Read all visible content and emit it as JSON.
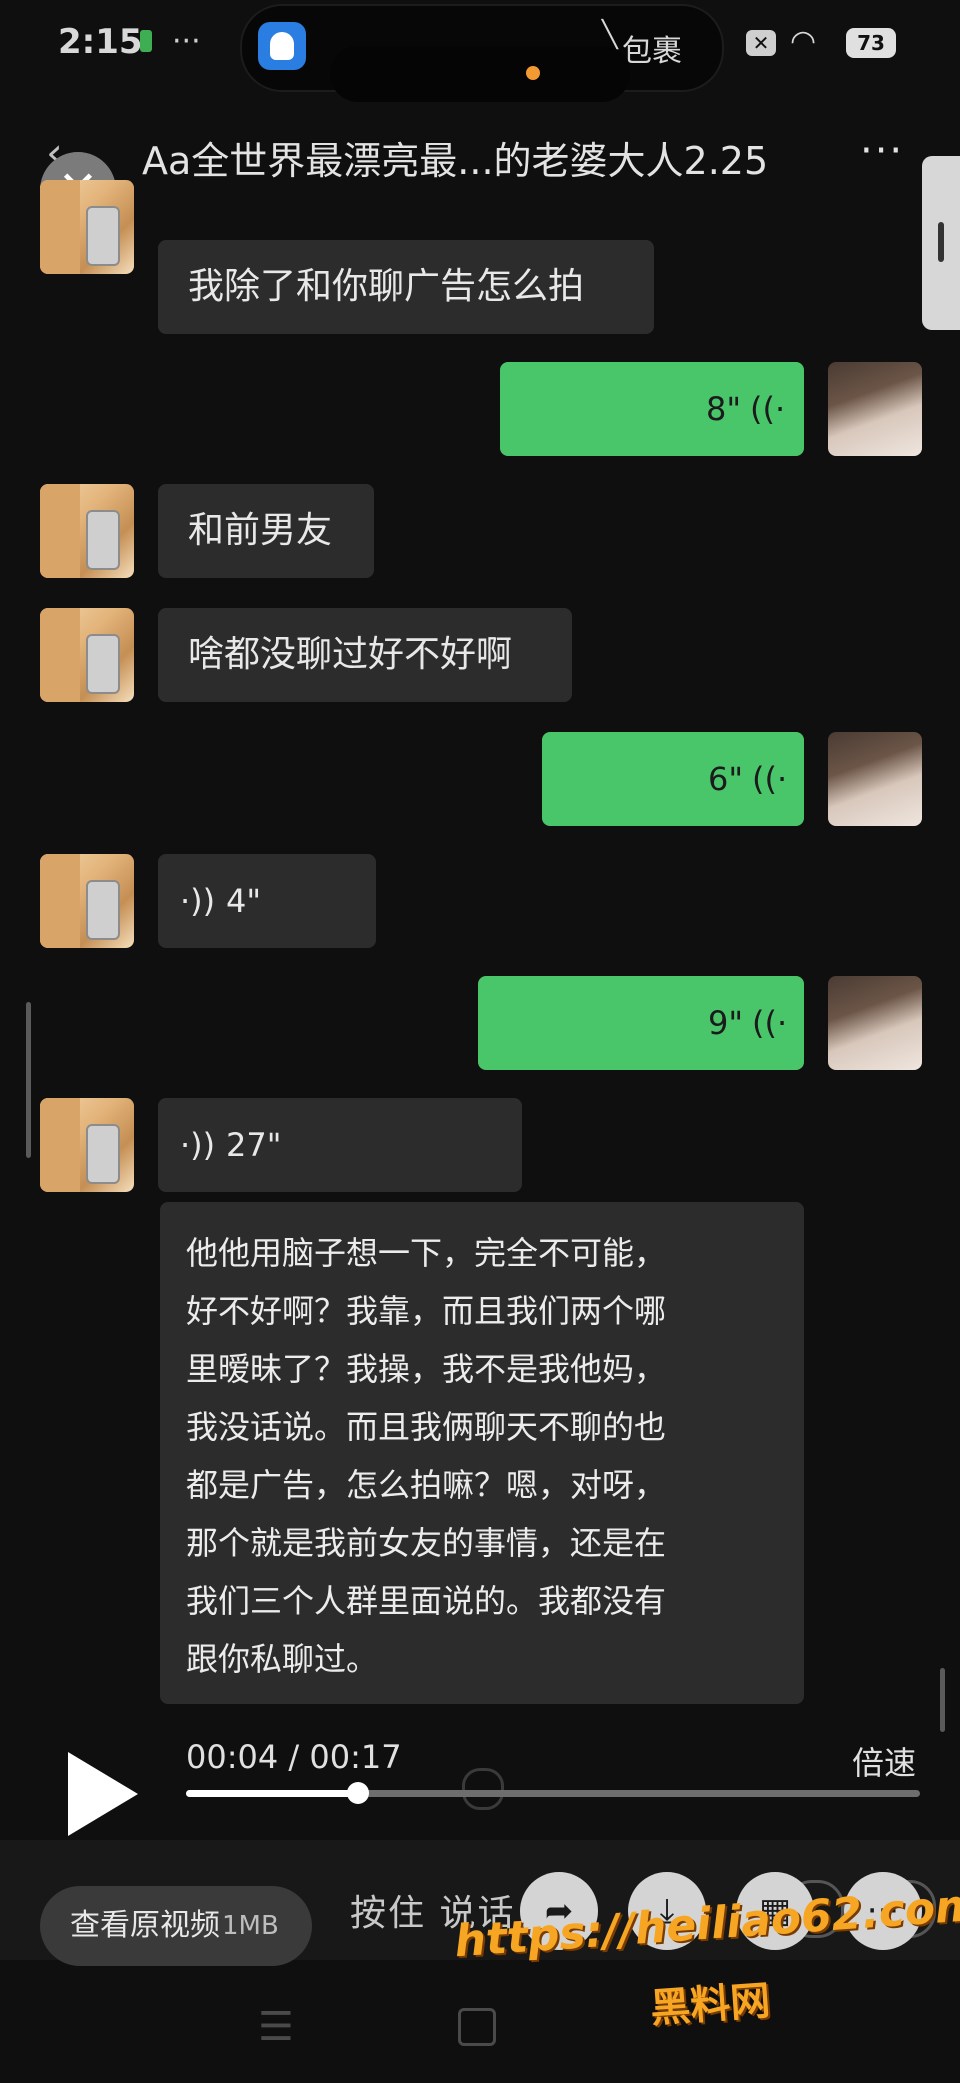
{
  "status_bar": {
    "time": "2:15",
    "dots": "···",
    "island_text": "包裹",
    "battery": "73"
  },
  "header": {
    "title": "Aa全世界最漂亮最...的老婆大人2.25",
    "more": "···",
    "back": "‹",
    "close": "✕"
  },
  "messages": [
    {
      "side": "left",
      "type": "text",
      "text": "我除了和你聊广告怎么拍"
    },
    {
      "side": "right",
      "type": "voice",
      "duration": "8\""
    },
    {
      "side": "left",
      "type": "text",
      "text": "和前男友"
    },
    {
      "side": "left",
      "type": "text",
      "text": "啥都没聊过好不好啊"
    },
    {
      "side": "right",
      "type": "voice",
      "duration": "6\""
    },
    {
      "side": "left",
      "type": "voice",
      "duration": "4\""
    },
    {
      "side": "right",
      "type": "voice",
      "duration": "9\""
    },
    {
      "side": "left",
      "type": "voice",
      "duration": "27\""
    }
  ],
  "transcript": [
    "他他用脑子想一下，完全不可能，",
    "好不好啊？我靠，而且我们两个哪",
    "里暧昧了？我操，我不是我他妈，",
    "我没话说。而且我俩聊天不聊的也",
    "都是广告，怎么拍嘛？嗯，对呀，",
    "那个就是我前女友的事情，还是在",
    "我们三个人群里面说的。我都没有",
    "跟你私聊过。"
  ],
  "player": {
    "time": "00:04 / 00:17",
    "speed": "倍速",
    "progress": 0.235
  },
  "bottom": {
    "view_original": "查看原视频",
    "size": "1MB",
    "hold_to_talk": "按住 说话"
  },
  "watermark": {
    "url": "https://heiliao62.com",
    "name": "黑料网"
  },
  "colors": {
    "background": "#0f0f10",
    "outgoing_bubble": "#4ac66a",
    "incoming_bubble": "#2c2c2c",
    "watermark": "#f6a623"
  }
}
